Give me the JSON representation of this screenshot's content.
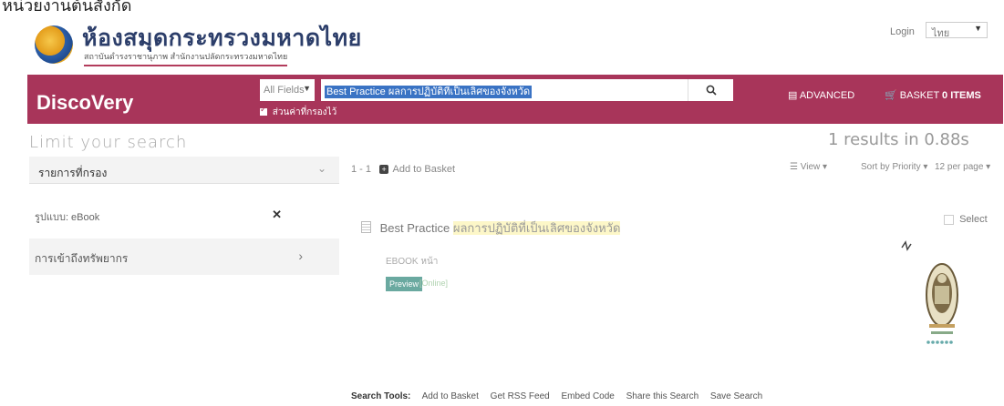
{
  "top_strip": {
    "text": "หน่วยงานต้นสังกัด"
  },
  "header": {
    "site_title": "ห้องสมุดกระทรวงมหาดไทย",
    "site_subtitle": "สถาบันดำรงราชานุภาพ สำนักงานปลัดกระทรวงมหาดไทย",
    "login_label": "Login",
    "language_value": "ไทย"
  },
  "search_bar": {
    "brand": "DiscoVery",
    "field_select_value": "All Fields",
    "query_value": "Best Practice ผลการปฏิบัติที่เป็นเลิศของจังหวัด",
    "keep_filters_label": "ส่วนค่าที่กรองไว้",
    "advanced_label": "ADVANCED",
    "basket_label": "BASKET",
    "basket_count": "0 ITEMS"
  },
  "sidebar": {
    "heading": "Limit your search",
    "facet_header": "รายการที่กรอง",
    "active_filter": "รูปแบบ: eBook",
    "facet_access": "การเข้าถึงทรัพยากร"
  },
  "results": {
    "summary": "1 results in 0.88s",
    "range": "1 - 1",
    "add_to_basket": "Add to Basket",
    "view_label": "View",
    "sort_label": "Sort by Priority",
    "per_page_label": "12 per page",
    "items": [
      {
        "title_prefix": "Best Practice",
        "title_rest": "ผลการปฏิบัติที่เป็นเลิศของจังหวัด",
        "format": "EBOOK",
        "pages": "หน้า",
        "preview_label": "Preview",
        "online_label": "[Online]",
        "select_label": "Select"
      }
    ]
  },
  "search_tools": {
    "label": "Search Tools:",
    "links": [
      "Add to Basket",
      "Get RSS Feed",
      "Embed Code",
      "Share this Search",
      "Save Search"
    ]
  },
  "colors": {
    "brand_bar": "#a8355a",
    "preview_button": "#6aa9a0"
  }
}
